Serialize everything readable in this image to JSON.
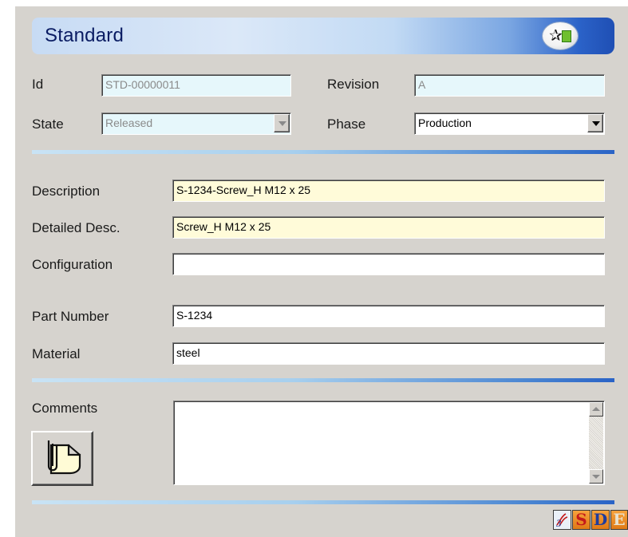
{
  "header": {
    "title": "Standard",
    "icon": "new-standard-icon"
  },
  "fields": {
    "id": {
      "label": "Id",
      "value": "STD-00000011",
      "enabled": false
    },
    "revision": {
      "label": "Revision",
      "value": "A",
      "enabled": false
    },
    "state": {
      "label": "State",
      "value": "Released",
      "enabled": false
    },
    "phase": {
      "label": "Phase",
      "value": "Production",
      "enabled": true
    },
    "description": {
      "label": "Description",
      "value": "S-1234-Screw_H M12 x 25"
    },
    "detailed_desc": {
      "label": "Detailed Desc.",
      "value": "Screw_H M12 x 25"
    },
    "configuration": {
      "label": "Configuration",
      "value": ""
    },
    "part_number": {
      "label": "Part Number",
      "value": "S-1234"
    },
    "material": {
      "label": "Material",
      "value": "steel"
    },
    "comments": {
      "label": "Comments",
      "value": ""
    }
  },
  "buttons": {
    "attach_icon": "attachment-document-icon"
  },
  "branding": {
    "logo_letters": [
      "S",
      "D",
      "E"
    ],
    "logo_icon": "3ds-logo-icon"
  },
  "colors": {
    "panel_background": "#d6d3ce",
    "header_text": "#0a1c63",
    "disabled_field": "#e6f7fb",
    "required_field": "#fffbd9",
    "separator_accent": "#2a63c6",
    "logo_orange": "#f6a23c",
    "logo_red": "#c41a1a",
    "logo_blue": "#1f3c9c"
  }
}
